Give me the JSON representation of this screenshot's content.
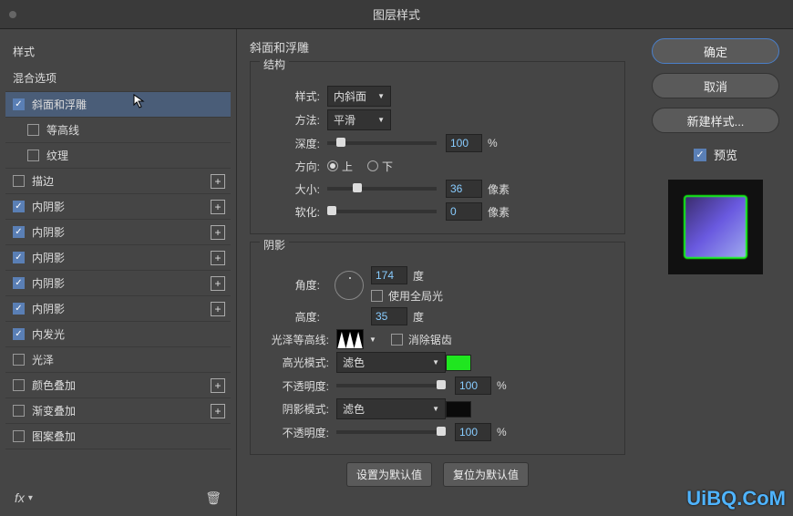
{
  "title": "图层样式",
  "sidebar": {
    "header": "样式",
    "blending": "混合选项",
    "items": [
      {
        "label": "斜面和浮雕",
        "checked": true,
        "selected": true,
        "plus": false,
        "sub": false
      },
      {
        "label": "等高线",
        "checked": false,
        "selected": false,
        "plus": false,
        "sub": true
      },
      {
        "label": "纹理",
        "checked": false,
        "selected": false,
        "plus": false,
        "sub": true
      },
      {
        "label": "描边",
        "checked": false,
        "selected": false,
        "plus": true,
        "sub": false
      },
      {
        "label": "内阴影",
        "checked": true,
        "selected": false,
        "plus": true,
        "sub": false
      },
      {
        "label": "内阴影",
        "checked": true,
        "selected": false,
        "plus": true,
        "sub": false
      },
      {
        "label": "内阴影",
        "checked": true,
        "selected": false,
        "plus": true,
        "sub": false
      },
      {
        "label": "内阴影",
        "checked": true,
        "selected": false,
        "plus": true,
        "sub": false
      },
      {
        "label": "内阴影",
        "checked": true,
        "selected": false,
        "plus": true,
        "sub": false
      },
      {
        "label": "内发光",
        "checked": true,
        "selected": false,
        "plus": false,
        "sub": false
      },
      {
        "label": "光泽",
        "checked": false,
        "selected": false,
        "plus": false,
        "sub": false
      },
      {
        "label": "颜色叠加",
        "checked": false,
        "selected": false,
        "plus": true,
        "sub": false
      },
      {
        "label": "渐变叠加",
        "checked": false,
        "selected": false,
        "plus": true,
        "sub": false
      },
      {
        "label": "图案叠加",
        "checked": false,
        "selected": false,
        "plus": false,
        "sub": false
      }
    ],
    "fx": "fx"
  },
  "main": {
    "title": "斜面和浮雕",
    "structure": {
      "group": "结构",
      "style_label": "样式:",
      "style_value": "内斜面",
      "technique_label": "方法:",
      "technique_value": "平滑",
      "depth_label": "深度:",
      "depth_value": "100",
      "depth_unit": "%",
      "direction_label": "方向:",
      "up": "上",
      "down": "下",
      "size_label": "大小:",
      "size_value": "36",
      "size_unit": "像素",
      "soften_label": "软化:",
      "soften_value": "0",
      "soften_unit": "像素"
    },
    "shading": {
      "group": "阴影",
      "angle_label": "角度:",
      "angle_value": "174",
      "angle_unit": "度",
      "global_label": "使用全局光",
      "altitude_label": "高度:",
      "altitude_value": "35",
      "altitude_unit": "度",
      "gloss_label": "光泽等高线:",
      "antialias_label": "消除锯齿",
      "highlight_mode_label": "高光模式:",
      "highlight_mode_value": "滤色",
      "highlight_opacity_label": "不透明度:",
      "highlight_opacity_value": "100",
      "highlight_opacity_unit": "%",
      "highlight_color": "#1fe61f",
      "shadow_mode_label": "阴影模式:",
      "shadow_mode_value": "滤色",
      "shadow_opacity_label": "不透明度:",
      "shadow_opacity_value": "100",
      "shadow_opacity_unit": "%",
      "shadow_color": "#0a0a0a"
    },
    "defaults_set": "设置为默认值",
    "defaults_reset": "复位为默认值"
  },
  "right": {
    "ok": "确定",
    "cancel": "取消",
    "new_style": "新建样式...",
    "preview": "预览"
  },
  "watermark": "UiBQ.CoM"
}
